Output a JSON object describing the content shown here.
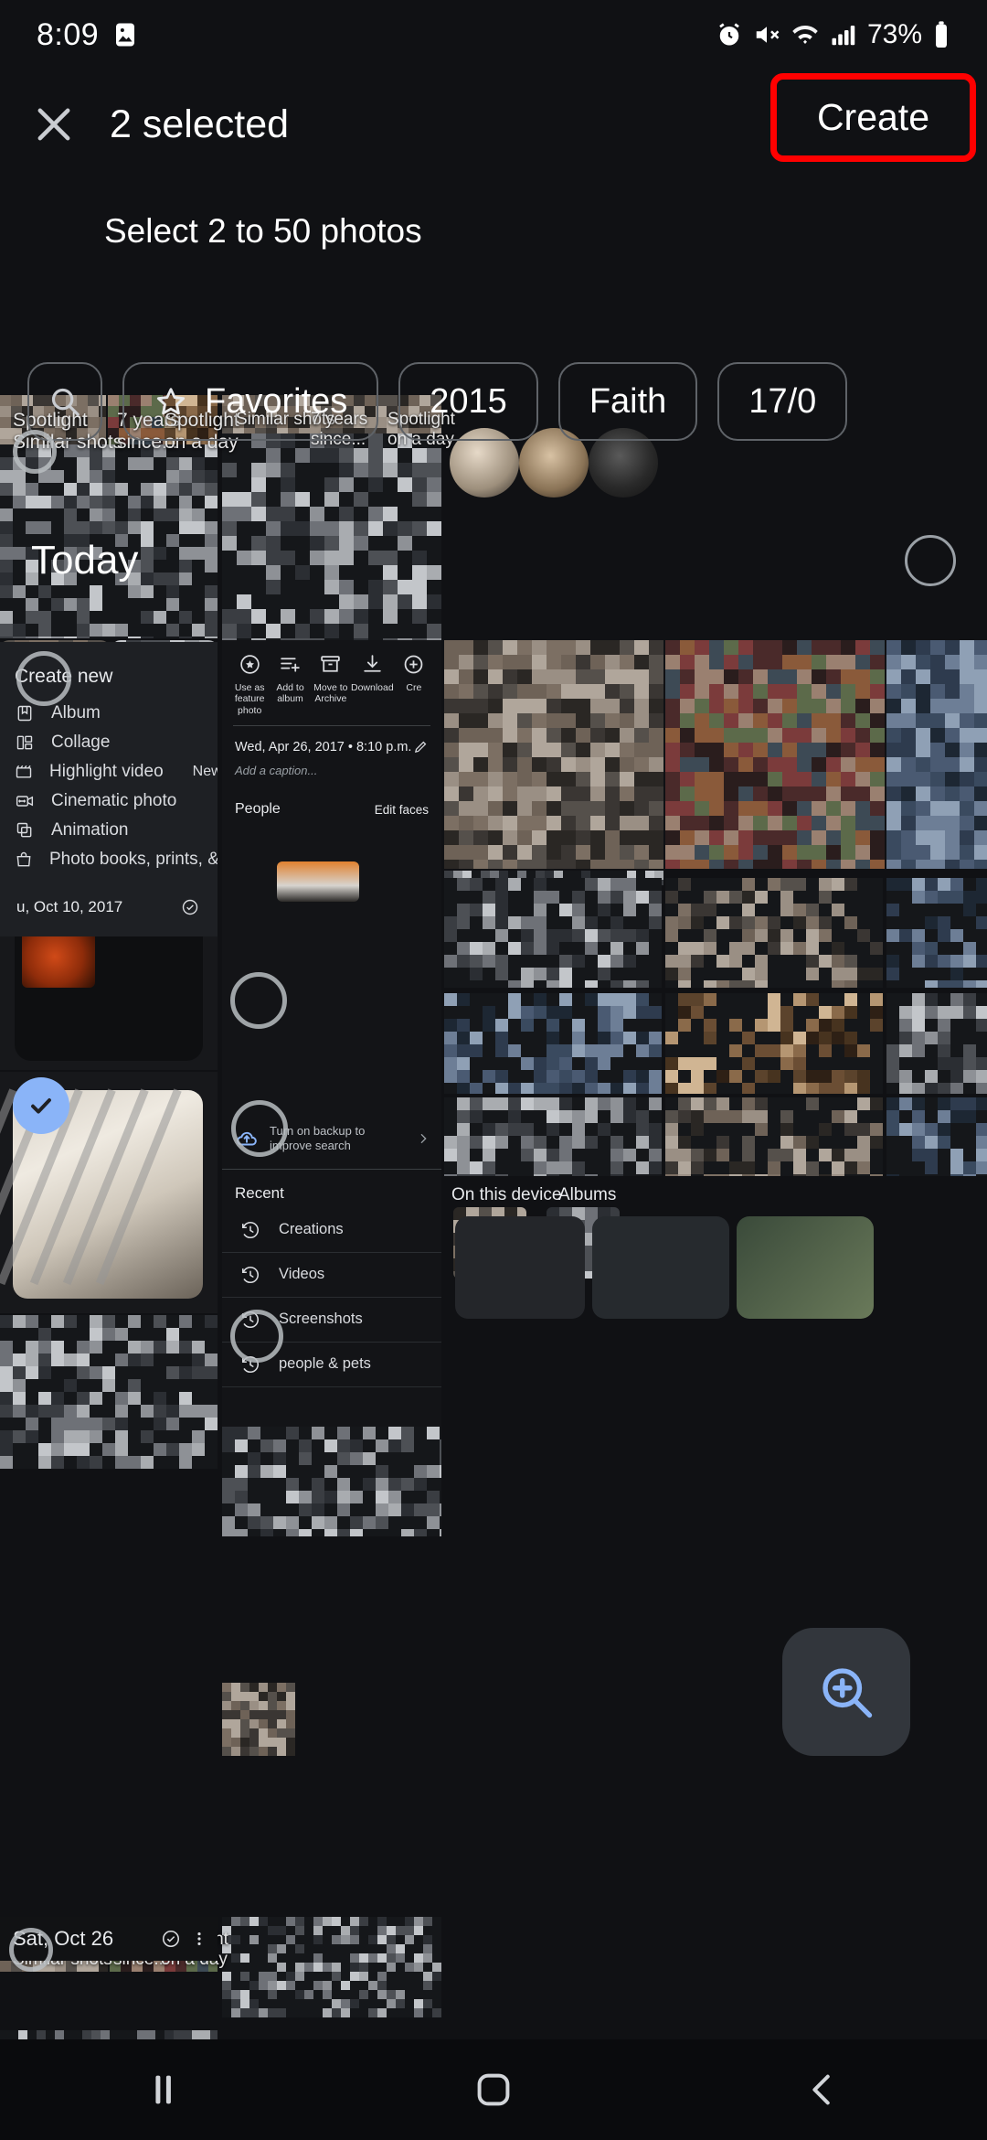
{
  "status_bar": {
    "time": "8:09",
    "battery": "73%",
    "icons": [
      "photos-notification-icon",
      "alarm-icon",
      "mute-icon",
      "wifi-icon",
      "signal-icon",
      "battery-icon"
    ]
  },
  "app_bar": {
    "close_icon": "close-icon",
    "title": "2 selected",
    "subtitle": "Select 2 to 50 photos",
    "create_label": "Create",
    "highlight_color": "#ff0000"
  },
  "filter_chips": [
    {
      "label": "",
      "icon": "search-icon"
    },
    {
      "label": "Favorites",
      "icon": "star-icon"
    },
    {
      "label": "2015",
      "icon": ""
    },
    {
      "label": "Faith",
      "icon": ""
    },
    {
      "label": "17/0",
      "icon": ""
    }
  ],
  "section": {
    "today_label": "Today",
    "select_all_icon": "select-circle-icon"
  },
  "create_menu": {
    "title": "Create new",
    "items": [
      {
        "label": "Album",
        "icon": "album-icon",
        "badge": ""
      },
      {
        "label": "Collage",
        "icon": "collage-icon",
        "badge": ""
      },
      {
        "label": "Highlight video",
        "icon": "movie-icon",
        "badge": "New"
      },
      {
        "label": "Cinematic photo",
        "icon": "cinematic-icon",
        "badge": ""
      },
      {
        "label": "Animation",
        "icon": "animation-icon",
        "badge": ""
      },
      {
        "label": "Photo books, prints, & more",
        "icon": "shop-icon",
        "badge": ""
      }
    ]
  },
  "detail_panel": {
    "actions": [
      {
        "label": "Use as feature photo",
        "icon": "star-circle-icon"
      },
      {
        "label": "Add to album",
        "icon": "add-to-album-icon"
      },
      {
        "label": "Move to Archive",
        "icon": "archive-icon"
      },
      {
        "label": "Download",
        "icon": "download-icon"
      },
      {
        "label": "Cre",
        "icon": "create-icon"
      }
    ],
    "date_text": "Wed, Apr 26, 2017 • 8:10 p.m.",
    "edit_icon": "pencil-icon",
    "caption_placeholder": "Add a caption...",
    "people_title": "People",
    "edit_faces_label": "Edit faces"
  },
  "search_panel": {
    "backup_text": "Turn on backup to improve search",
    "backup_icon": "cloud-upload-icon",
    "chevron_icon": "chevron-right-icon",
    "recent_title": "Recent",
    "items": [
      {
        "label": "Creations",
        "icon": "history-icon"
      },
      {
        "label": "Videos",
        "icon": "history-icon"
      },
      {
        "label": "Screenshots",
        "icon": "history-icon"
      },
      {
        "label": "people & pets",
        "icon": "history-icon"
      }
    ]
  },
  "library_labels": {
    "on_this_device": "On this device",
    "albums": "Albums"
  },
  "memory_cards": [
    {
      "line1": "Spotlight",
      "line2": "Similar shots"
    },
    {
      "line1": "7 years",
      "line2": "since..."
    },
    {
      "line1": "Spotlight",
      "line2": "on a day"
    }
  ],
  "bottom": {
    "date_label": "Sat, Oct 26",
    "check_icon": "check-circle-icon",
    "more_icon": "more-vert-icon"
  },
  "selected_tile": {
    "date_label": "u, Oct 10, 2017",
    "check_icon": "check-circle-icon"
  },
  "fab": {
    "icon": "zoom-in-icon"
  },
  "nav_bar": {
    "recents_icon": "recents-icon",
    "home_icon": "home-icon",
    "back_icon": "back-icon"
  },
  "colors": {
    "background": "#101114",
    "panel": "#1b1d21",
    "accent_selection": "#8ab4f8",
    "highlight": "#ff0000",
    "text_primary": "#e8eaed",
    "text_secondary": "#9aa0a6"
  }
}
